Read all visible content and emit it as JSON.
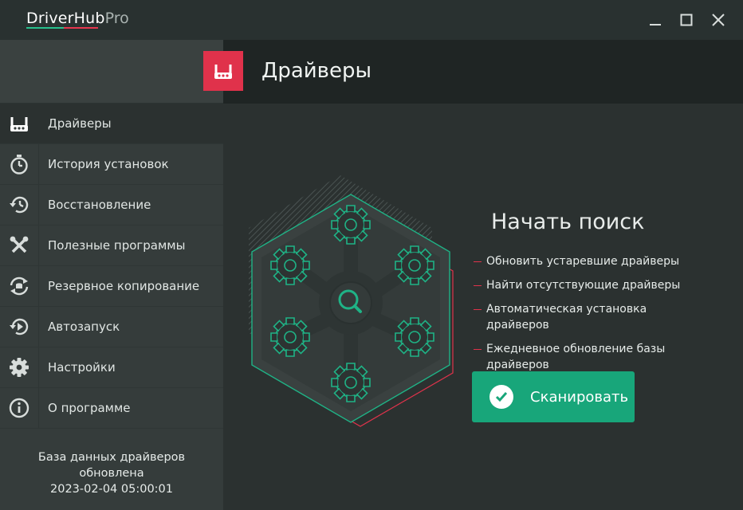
{
  "app": {
    "brand": "DriverHub",
    "edition": "Pro"
  },
  "window_controls": {
    "minimize_icon": "minimize-icon",
    "maximize_icon": "maximize-icon",
    "close_icon": "close-icon"
  },
  "header": {
    "title": "Драйверы",
    "icon": "drivers-icon",
    "icon_bg": "#e0324b"
  },
  "sidebar": {
    "items": [
      {
        "label": "Драйверы",
        "icon": "drivers-icon",
        "active": true
      },
      {
        "label": "История установок",
        "icon": "stopwatch-icon",
        "active": false
      },
      {
        "label": "Восстановление",
        "icon": "restore-icon",
        "active": false
      },
      {
        "label": "Полезные программы",
        "icon": "tools-icon",
        "active": false
      },
      {
        "label": "Резервное копирование",
        "icon": "backup-icon",
        "active": false
      },
      {
        "label": "Автозапуск",
        "icon": "autostart-icon",
        "active": false
      },
      {
        "label": "Настройки",
        "icon": "gear-icon",
        "active": false
      },
      {
        "label": "О программе",
        "icon": "info-icon",
        "active": false
      }
    ],
    "db_status": {
      "line1": "База данных драйверов",
      "line2": "обновлена",
      "timestamp": "2023-02-04 05:00:01"
    }
  },
  "main": {
    "scan_title": "Начать поиск",
    "features": [
      "Обновить устаревшие драйверы",
      "Найти отсутствующие драйверы",
      "Автоматическая установка драйверов",
      "Ежедневное обновление базы драйверов"
    ],
    "scan_button": "Сканировать",
    "colors": {
      "accent_green": "#18a67a",
      "accent_red": "#e0324b"
    }
  }
}
